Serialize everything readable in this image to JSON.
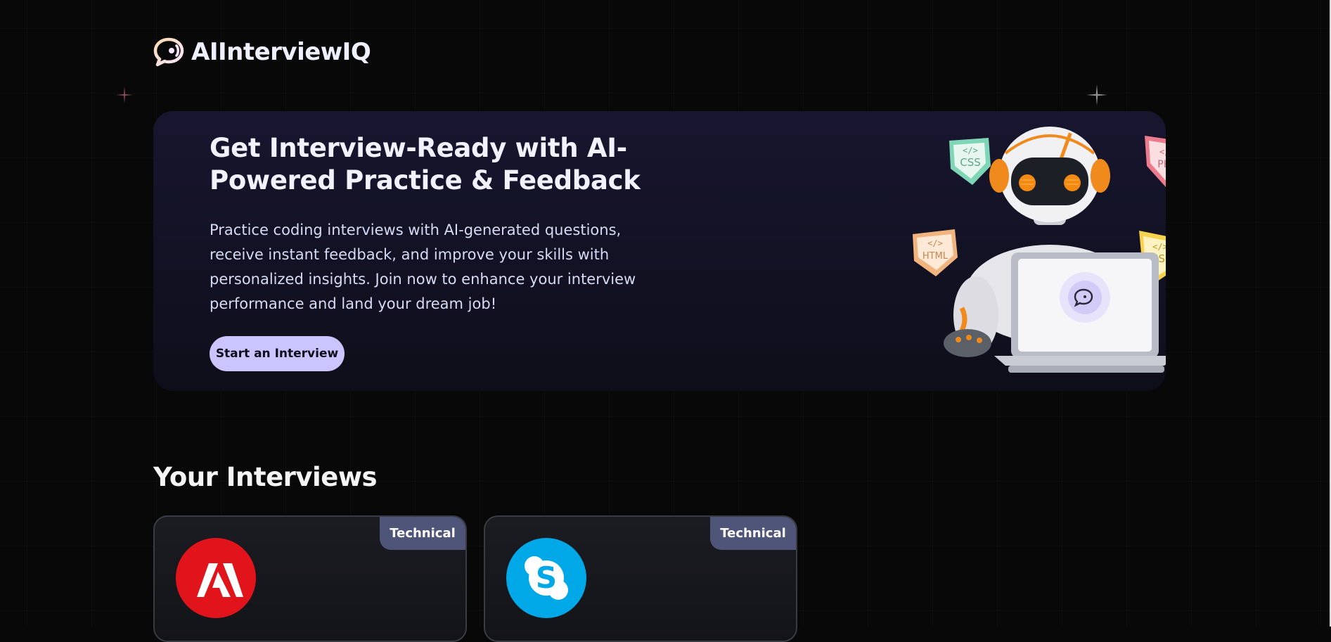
{
  "app": {
    "name": "AIInterviewIQ",
    "logo_icon": "chat-bubble-icon",
    "accent_color": "#cac5fe"
  },
  "hero": {
    "title": "Get Interview-Ready with AI-Powered Practice & Feedback",
    "description": "Practice coding interviews with AI-generated questions, receive instant feedback, and improve your skills with personalized insights. Join now to enhance your interview performance and land your dream job!",
    "cta_label": "Start an Interview",
    "illustration": {
      "subject": "robot-with-laptop",
      "tags": [
        "CSS",
        "PHP",
        "HTML",
        "JS"
      ]
    }
  },
  "interviews": {
    "title": "Your Interviews",
    "cards": [
      {
        "type_label": "Technical",
        "company_icon": "adobe-logo-icon",
        "company_color": "#e1141c"
      },
      {
        "type_label": "Technical",
        "company_icon": "skype-logo-icon",
        "company_color": "#00a8e8"
      }
    ]
  }
}
